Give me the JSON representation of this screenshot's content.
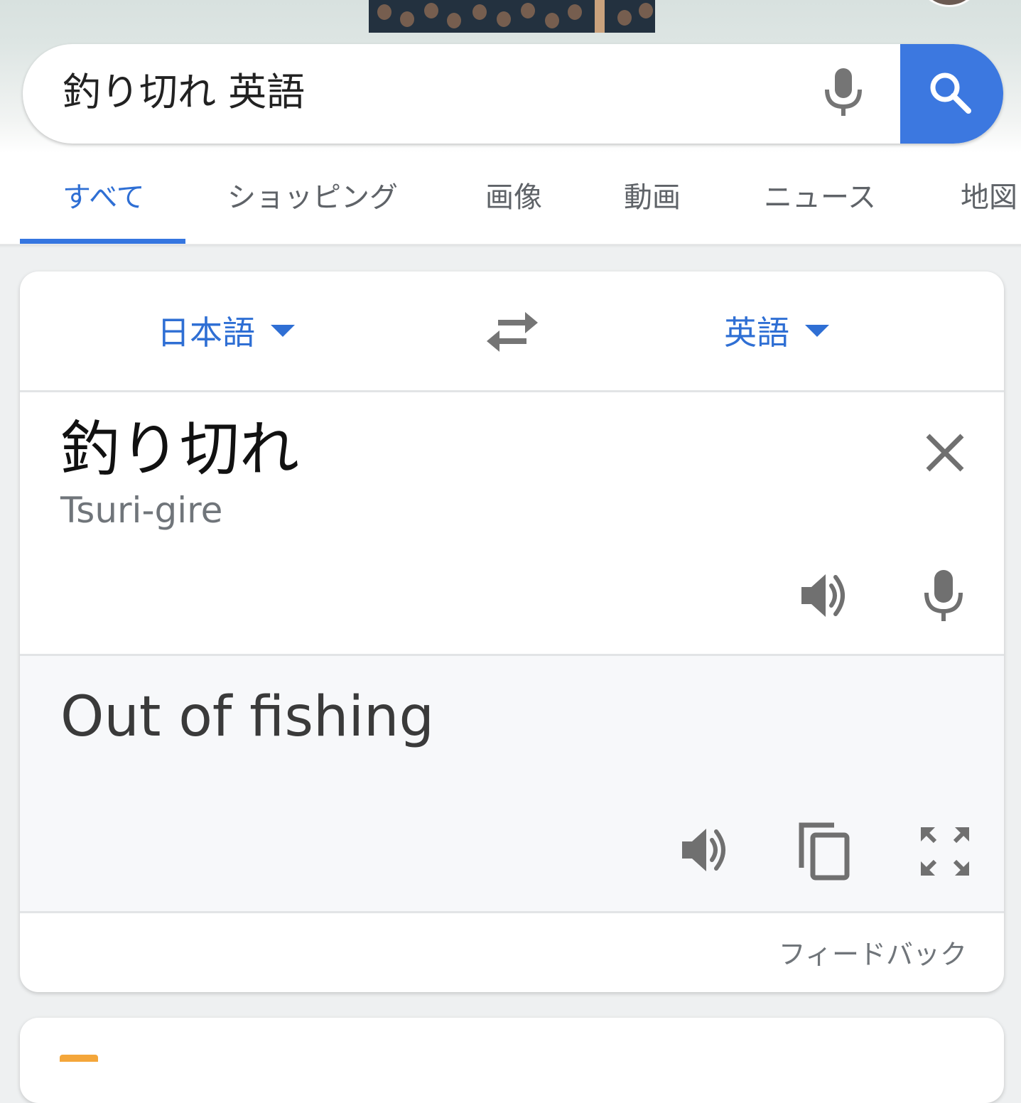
{
  "search": {
    "query": "釣り切れ 英語"
  },
  "tabs": [
    {
      "label": "すべて",
      "active": true
    },
    {
      "label": "ショッピング",
      "active": false
    },
    {
      "label": "画像",
      "active": false
    },
    {
      "label": "動画",
      "active": false
    },
    {
      "label": "ニュース",
      "active": false
    },
    {
      "label": "地図",
      "active": false
    }
  ],
  "translate": {
    "source_language": "日本語",
    "target_language": "英語",
    "source_text": "釣り切れ",
    "romanization": "Tsuri-gire",
    "translated_text": "Out of fishing",
    "feedback_label": "フィードバック"
  },
  "icons": {
    "search_mic": "mic-icon",
    "search": "search-icon",
    "swap": "swap-arrows-icon",
    "clear": "close-icon",
    "speaker": "speaker-icon",
    "copy": "copy-icon",
    "fullscreen": "fullscreen-icon"
  },
  "colors": {
    "accent": "#3c78e0",
    "active_tab": "#2f6fd4",
    "icon_gray": "#757575",
    "result_background": "#f7f8fa"
  }
}
